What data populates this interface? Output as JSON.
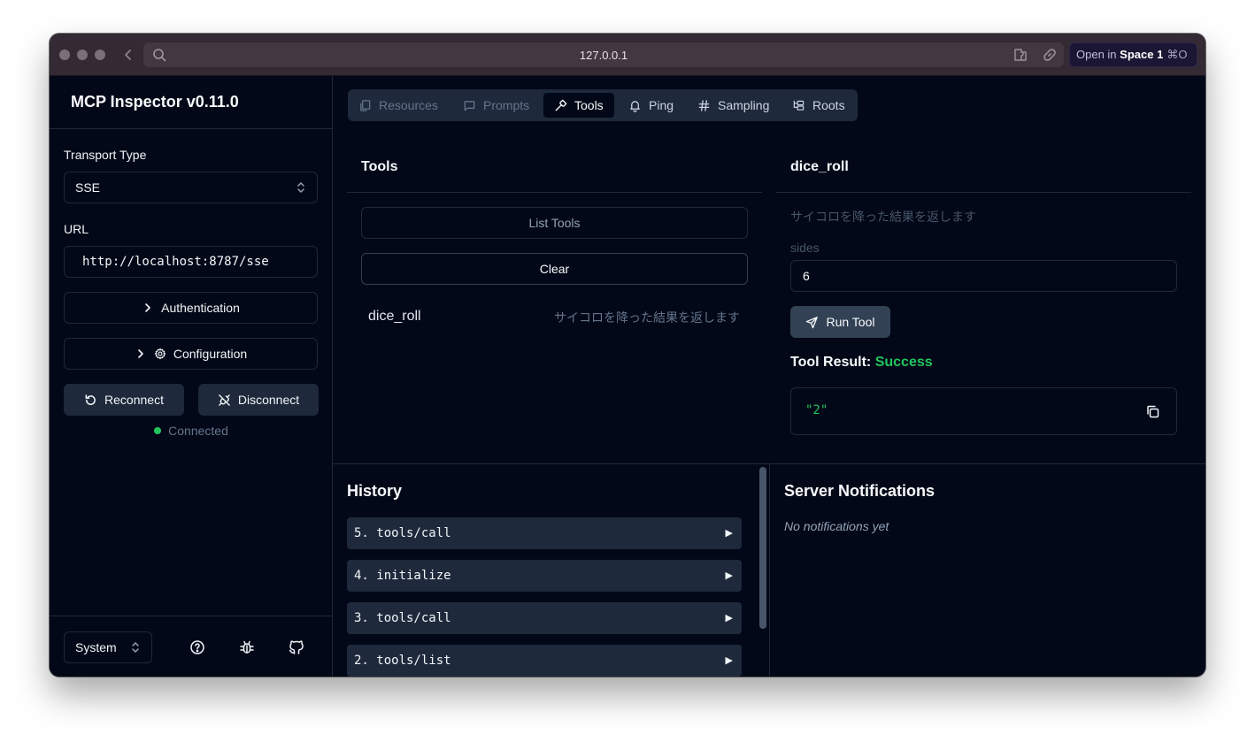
{
  "browser": {
    "url": "127.0.0.1",
    "open_in_prefix": "Open in",
    "open_in_target": "Space 1",
    "open_in_shortcut": "⌘O"
  },
  "sidebar": {
    "title": "MCP Inspector v0.11.0",
    "transport_label": "Transport Type",
    "transport_value": "SSE",
    "url_label": "URL",
    "url_value": "http://localhost:8787/sse",
    "authentication_label": "Authentication",
    "configuration_label": "Configuration",
    "reconnect_label": "Reconnect",
    "disconnect_label": "Disconnect",
    "status_text": "Connected",
    "status_color": "#22c55e",
    "theme_value": "System"
  },
  "tabs": [
    {
      "label": "Resources",
      "icon": "files-icon"
    },
    {
      "label": "Prompts",
      "icon": "message-square-icon"
    },
    {
      "label": "Tools",
      "icon": "hammer-icon"
    },
    {
      "label": "Ping",
      "icon": "bell-icon"
    },
    {
      "label": "Sampling",
      "icon": "hash-icon"
    },
    {
      "label": "Roots",
      "icon": "folder-tree-icon"
    }
  ],
  "tools_panel": {
    "title": "Tools",
    "list_button": "List Tools",
    "clear_button": "Clear",
    "items": [
      {
        "name": "dice_roll",
        "description": "サイコロを降った結果を返します"
      }
    ]
  },
  "tool_detail": {
    "name": "dice_roll",
    "description": "サイコロを降った結果を返します",
    "param_label": "sides",
    "param_value": "6",
    "run_button": "Run Tool",
    "result_label": "Tool Result:",
    "result_status": "Success",
    "result_value": "\"2\""
  },
  "history": {
    "title": "History",
    "items": [
      "5. tools/call",
      "4. initialize",
      "3. tools/call",
      "2. tools/list"
    ],
    "expand_glyph": "▶"
  },
  "notifications": {
    "title": "Server Notifications",
    "empty_text": "No notifications yet"
  }
}
